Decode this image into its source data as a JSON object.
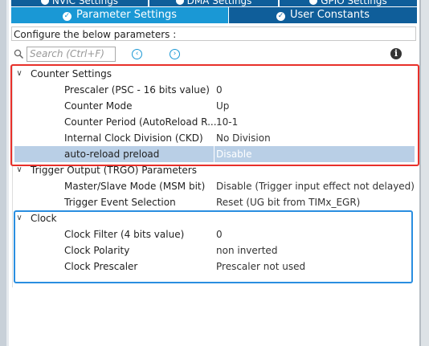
{
  "top_tabs": [
    {
      "label": "NVIC Settings"
    },
    {
      "label": "DMA Settings"
    },
    {
      "label": "GPIO Settings"
    }
  ],
  "tabs": {
    "parameter_settings": "Parameter Settings",
    "user_constants": "User Constants"
  },
  "configure_text": "Configure the below parameters :",
  "search": {
    "placeholder": "Search (Ctrl+F)"
  },
  "icons": {
    "search": "search-icon",
    "prev": "prev-arrow-icon",
    "next": "next-arrow-icon",
    "info": "info-icon"
  },
  "info_label": "i",
  "groups": {
    "counter_settings": {
      "name": "Counter Settings",
      "params": [
        {
          "label": "Prescaler (PSC - 16 bits value)",
          "value": "0"
        },
        {
          "label": "Counter Mode",
          "value": "Up"
        },
        {
          "label": "Counter Period (AutoReload R...",
          "value": "10-1"
        },
        {
          "label": "Internal Clock Division (CKD)",
          "value": "No Division"
        },
        {
          "label": "auto-reload preload",
          "value": "Disable"
        }
      ]
    },
    "trigger_output": {
      "name": "Trigger Output (TRGO) Parameters",
      "params": [
        {
          "label": "Master/Slave Mode (MSM bit)",
          "value": "Disable (Trigger input effect not delayed)"
        },
        {
          "label": "Trigger Event Selection",
          "value": "Reset (UG bit from TIMx_EGR)"
        }
      ]
    },
    "clock": {
      "name": "Clock",
      "params": [
        {
          "label": "Clock Filter (4 bits value)",
          "value": "0"
        },
        {
          "label": "Clock Polarity",
          "value": "non inverted"
        },
        {
          "label": "Clock Prescaler",
          "value": "Prescaler not used"
        }
      ]
    }
  },
  "colors": {
    "tab_active": "#1a98d5",
    "tab_inactive": "#0f5e9a",
    "highlight_red": "#e8302a",
    "highlight_blue": "#2a8ee0",
    "selected_row": "#b9cfe6"
  }
}
